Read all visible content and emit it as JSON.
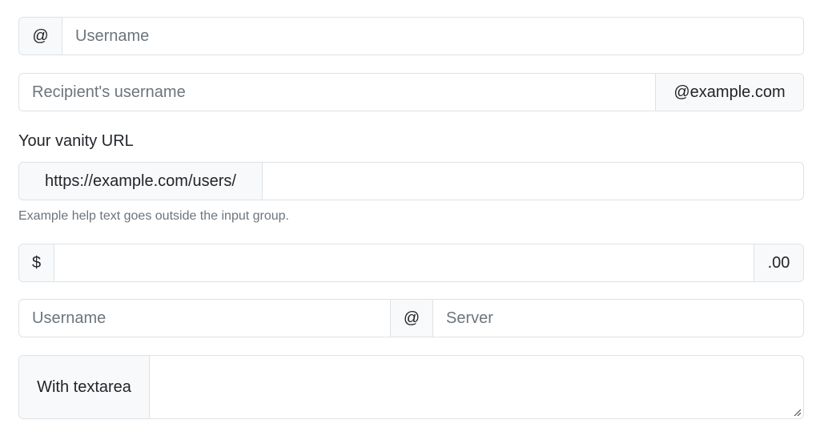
{
  "groups": {
    "username": {
      "addon": "@",
      "placeholder": "Username",
      "value": ""
    },
    "recipient": {
      "placeholder": "Recipient's username",
      "value": "",
      "addon": "@example.com"
    },
    "vanity": {
      "label": "Your vanity URL",
      "addon": "https://example.com/users/",
      "value": "",
      "help": "Example help text goes outside the input group."
    },
    "amount": {
      "prefix": "$",
      "value": "",
      "suffix": ".00"
    },
    "server": {
      "username_placeholder": "Username",
      "separator": "@",
      "server_placeholder": "Server"
    },
    "textarea": {
      "addon": "With textarea",
      "value": ""
    }
  }
}
